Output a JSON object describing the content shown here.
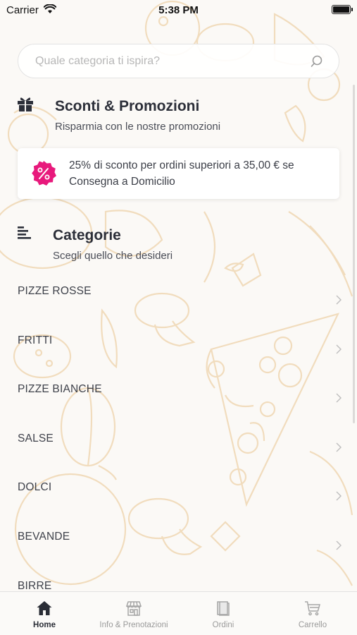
{
  "status_bar": {
    "carrier": "Carrier",
    "time": "5:38 PM"
  },
  "search": {
    "placeholder": "Quale categoria ti ispira?"
  },
  "promotions": {
    "title": "Sconti & Promozioni",
    "subtitle": "Risparmia con le nostre promozioni",
    "items": [
      {
        "text": "25% di sconto per ordini superiori a 35,00 € se Consegna a Domicilio",
        "icon": "percent-badge-icon",
        "color": "#e8197c"
      }
    ]
  },
  "categories": {
    "title": "Categorie",
    "subtitle": "Scegli quello che desideri",
    "items": [
      {
        "label": "PIZZE ROSSE"
      },
      {
        "label": "FRITTI"
      },
      {
        "label": "PIZZE BIANCHE"
      },
      {
        "label": "SALSE"
      },
      {
        "label": "DOLCI"
      },
      {
        "label": "BEVANDE"
      },
      {
        "label": "BIRRE"
      }
    ]
  },
  "tab_bar": {
    "active": "Home",
    "tabs": [
      {
        "label": "Home",
        "icon": "home-icon"
      },
      {
        "label": "Info & Prenotazioni",
        "icon": "store-icon"
      },
      {
        "label": "Ordini",
        "icon": "book-icon"
      },
      {
        "label": "Carrello",
        "icon": "cart-icon"
      }
    ]
  },
  "colors": {
    "accent": "#e8197c",
    "text": "#2a2d36",
    "art": "#f0d9b8"
  }
}
